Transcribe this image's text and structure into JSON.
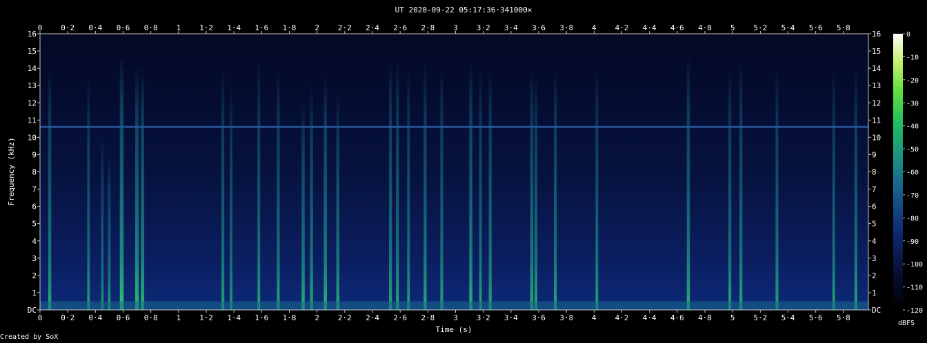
{
  "chart_data": {
    "type": "heatmap",
    "title": "UT 2020-09-22 05:17:36·341000×",
    "xlabel": "Time (s)",
    "ylabel": "Frequency (kHz)",
    "xlim": [
      0,
      5.98
    ],
    "ylim": [
      0,
      16
    ],
    "x_tick_labels": [
      "0",
      "0·2",
      "0·4",
      "0·6",
      "0·8",
      "1",
      "1·2",
      "1·4",
      "1·6",
      "1·8",
      "2",
      "2·2",
      "2·4",
      "2·6",
      "2·8",
      "3",
      "3·2",
      "3·4",
      "3·6",
      "3·8",
      "4",
      "4·2",
      "4·4",
      "4·6",
      "4·8",
      "5",
      "5·2",
      "5·4",
      "5·6",
      "5·8"
    ],
    "x_tick_values": [
      0,
      0.2,
      0.4,
      0.6,
      0.8,
      1,
      1.2,
      1.4,
      1.6,
      1.8,
      2,
      2.2,
      2.4,
      2.6,
      2.8,
      3,
      3.2,
      3.4,
      3.6,
      3.8,
      4,
      4.2,
      4.4,
      4.6,
      4.8,
      5,
      5.2,
      5.4,
      5.6,
      5.8
    ],
    "y_tick_labels": [
      "DC",
      "1",
      "2",
      "3",
      "4",
      "5",
      "6",
      "7",
      "8",
      "9",
      "10",
      "11",
      "12",
      "13",
      "14",
      "15",
      "16"
    ],
    "y_tick_values": [
      0,
      1,
      2,
      3,
      4,
      5,
      6,
      7,
      8,
      9,
      10,
      11,
      12,
      13,
      14,
      15,
      16
    ],
    "colorbar": {
      "label": "dBFS",
      "range": [
        -120,
        0
      ],
      "tick_labels": [
        "0",
        "-10",
        "-20",
        "-30",
        "-40",
        "-50",
        "-60",
        "-70",
        "-80",
        "-90",
        "-100",
        "-110",
        "-120"
      ],
      "tick_values": [
        0,
        -10,
        -20,
        -30,
        -40,
        -50,
        -60,
        -70,
        -80,
        -90,
        -100,
        -110,
        -120
      ],
      "colors": [
        "#000014",
        "#0a1a5a",
        "#1a4a8a",
        "#1a9a8a",
        "#22cc55",
        "#aaee44",
        "#ffffff"
      ]
    },
    "tone_line_khz": 10.6,
    "transients": [
      {
        "t": 0.07,
        "top_khz": 14.0,
        "level": -78
      },
      {
        "t": 0.35,
        "top_khz": 13.5,
        "level": -88
      },
      {
        "t": 0.45,
        "top_khz": 10.0,
        "level": -92
      },
      {
        "t": 0.5,
        "top_khz": 9.0,
        "level": -88
      },
      {
        "t": 0.59,
        "top_khz": 14.8,
        "level": -58
      },
      {
        "t": 0.7,
        "top_khz": 14.2,
        "level": -66
      },
      {
        "t": 0.74,
        "top_khz": 14.0,
        "level": -70
      },
      {
        "t": 1.32,
        "top_khz": 14.0,
        "level": -84
      },
      {
        "t": 1.38,
        "top_khz": 13.0,
        "level": -88
      },
      {
        "t": 1.58,
        "top_khz": 14.5,
        "level": -86
      },
      {
        "t": 1.72,
        "top_khz": 14.0,
        "level": -84
      },
      {
        "t": 1.9,
        "top_khz": 12.0,
        "level": -76
      },
      {
        "t": 1.96,
        "top_khz": 13.0,
        "level": -80
      },
      {
        "t": 2.06,
        "top_khz": 13.5,
        "level": -74
      },
      {
        "t": 2.15,
        "top_khz": 12.5,
        "level": -78
      },
      {
        "t": 2.53,
        "top_khz": 14.5,
        "level": -82
      },
      {
        "t": 2.58,
        "top_khz": 14.5,
        "level": -82
      },
      {
        "t": 2.66,
        "top_khz": 14.0,
        "level": -86
      },
      {
        "t": 2.78,
        "top_khz": 14.5,
        "level": -80
      },
      {
        "t": 2.9,
        "top_khz": 14.2,
        "level": -84
      },
      {
        "t": 3.11,
        "top_khz": 14.5,
        "level": -74
      },
      {
        "t": 3.18,
        "top_khz": 14.0,
        "level": -86
      },
      {
        "t": 3.25,
        "top_khz": 14.0,
        "level": -82
      },
      {
        "t": 3.55,
        "top_khz": 14.0,
        "level": -78
      },
      {
        "t": 3.58,
        "top_khz": 13.5,
        "level": -82
      },
      {
        "t": 3.72,
        "top_khz": 14.0,
        "level": -80
      },
      {
        "t": 4.02,
        "top_khz": 14.0,
        "level": -86
      },
      {
        "t": 4.68,
        "top_khz": 14.8,
        "level": -76
      },
      {
        "t": 4.98,
        "top_khz": 14.0,
        "level": -84
      },
      {
        "t": 5.06,
        "top_khz": 14.5,
        "level": -82
      },
      {
        "t": 5.32,
        "top_khz": 14.0,
        "level": -84
      },
      {
        "t": 5.73,
        "top_khz": 14.0,
        "level": -86
      },
      {
        "t": 5.89,
        "top_khz": 14.0,
        "level": -82
      }
    ],
    "grid": false
  },
  "credit": "Created by SoX"
}
